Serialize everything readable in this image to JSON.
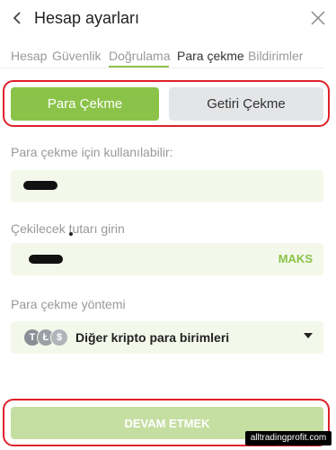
{
  "header": {
    "title": "Hesap ayarları"
  },
  "tabs": [
    {
      "label": "Hesap"
    },
    {
      "label": "Güvenlik"
    },
    {
      "label": "Doğrulama"
    },
    {
      "label": "Para çekme"
    },
    {
      "label": "Bildirimler"
    }
  ],
  "active_tab": "Doğrulama",
  "toggle": {
    "primary_label": "Para Çekme",
    "secondary_label": "Getiri Çekme"
  },
  "available": {
    "label": "Para çekme için kullanılabilir:"
  },
  "amount": {
    "label": "Çekilecek tutarı girin",
    "max_label": "MAKS"
  },
  "method": {
    "label": "Para çekme yöntemi",
    "selected": "Diğer kripto para birimleri",
    "coins": [
      "tether-icon",
      "litecoin-icon",
      "dollar-coin-icon"
    ]
  },
  "submit": {
    "label": "DEVAM ETMEK"
  },
  "watermark": "alltradingprofit.com",
  "colors": {
    "accent": "#8bc34a",
    "highlight_frame": "#e0202a",
    "field_bg": "#f3f8eb"
  }
}
